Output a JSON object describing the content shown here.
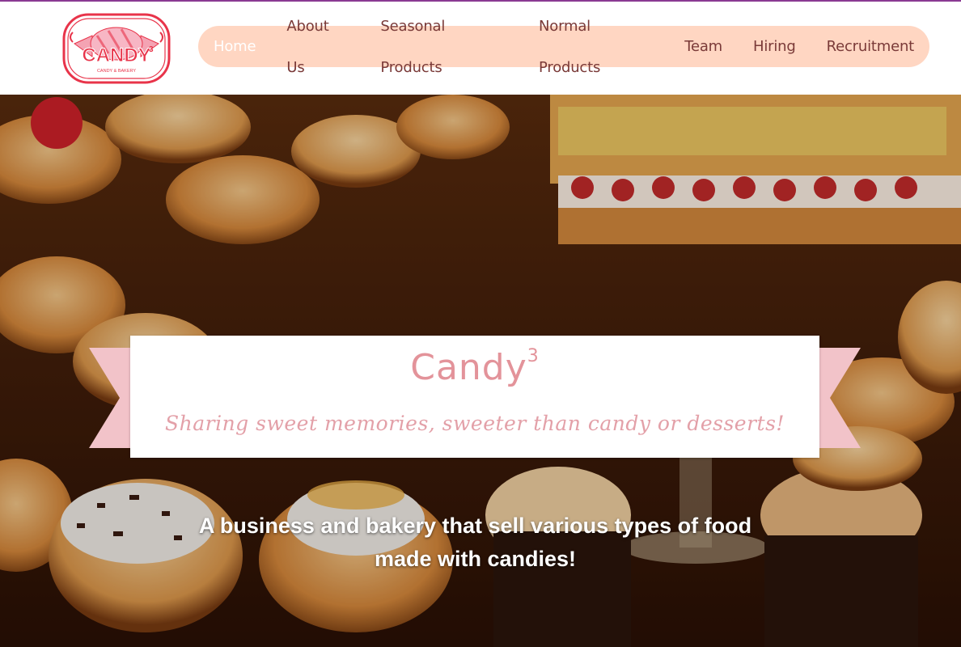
{
  "brand": {
    "logo_text": "CANDY",
    "logo_superscript": "3",
    "logo_tagline": "CANDY & BAKERY"
  },
  "nav": {
    "items": [
      {
        "label": "Home",
        "active": true
      },
      {
        "label": "About Us"
      },
      {
        "label": "Seasonal Products"
      },
      {
        "label": "Normal Products"
      },
      {
        "label": "Team"
      },
      {
        "label": "Hiring"
      },
      {
        "label": "Recruitment"
      }
    ]
  },
  "hero": {
    "title": "Candy",
    "title_superscript": "3",
    "subtitle": "Sharing sweet memories, sweeter than candy or desserts!",
    "description": "A business and bakery that sell various types of food made with candies!"
  },
  "colors": {
    "nav_background": "#ffd6c2",
    "nav_text": "#7a3a38",
    "accent_pink": "#e3939a",
    "ribbon_pink": "#f2c3c9",
    "logo_red": "#e8344a"
  }
}
